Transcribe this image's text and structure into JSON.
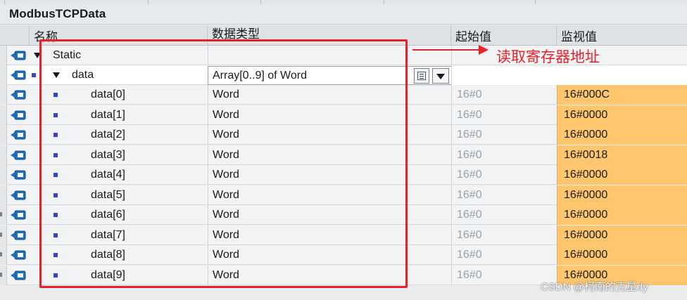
{
  "window": {
    "title": "ModbusTCPData"
  },
  "columns": {
    "name": "名称",
    "data_type": "数据类型",
    "start_value": "起始值",
    "monitor_value": "监视值"
  },
  "section": {
    "label": "Static"
  },
  "array_entry": {
    "name": "data",
    "data_type": "Array[0..9] of Word"
  },
  "elements": [
    {
      "name": "data[0]",
      "type": "Word",
      "start": "16#0",
      "monitor": "16#000C"
    },
    {
      "name": "data[1]",
      "type": "Word",
      "start": "16#0",
      "monitor": "16#0000"
    },
    {
      "name": "data[2]",
      "type": "Word",
      "start": "16#0",
      "monitor": "16#0000"
    },
    {
      "name": "data[3]",
      "type": "Word",
      "start": "16#0",
      "monitor": "16#0018"
    },
    {
      "name": "data[4]",
      "type": "Word",
      "start": "16#0",
      "monitor": "16#0000"
    },
    {
      "name": "data[5]",
      "type": "Word",
      "start": "16#0",
      "monitor": "16#0000"
    },
    {
      "name": "data[6]",
      "type": "Word",
      "start": "16#0",
      "monitor": "16#0000"
    },
    {
      "name": "data[7]",
      "type": "Word",
      "start": "16#0",
      "monitor": "16#0000"
    },
    {
      "name": "data[8]",
      "type": "Word",
      "start": "16#0",
      "monitor": "16#0000"
    },
    {
      "name": "data[9]",
      "type": "Word",
      "start": "16#0",
      "monitor": "16#0000"
    }
  ],
  "annotation": {
    "text": "读取寄存器地址",
    "color": "#e8202a"
  },
  "watermark": {
    "text": "CSDN @柯南的克星dy"
  },
  "colors": {
    "monitor_highlight": "#ffc66e",
    "bullet": "#3346c6",
    "annotation_red": "#e8202a"
  },
  "icons": {
    "row_icon": "db-tag-icon",
    "expand": "triangle-down-icon",
    "element": "square-bullet-icon"
  }
}
